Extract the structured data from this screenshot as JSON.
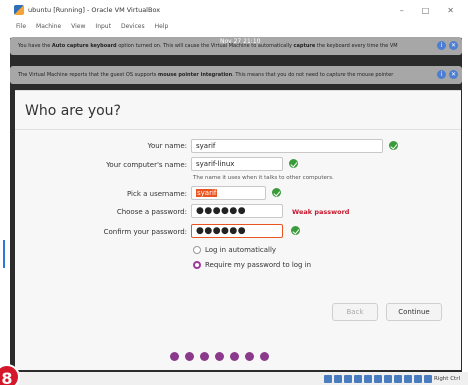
{
  "window": {
    "title": "ubuntu [Running] - Oracle VM VirtualBox",
    "minimize": "–",
    "maximize": "□",
    "close": "✕"
  },
  "menu": [
    "File",
    "Machine",
    "View",
    "Input",
    "Devices",
    "Help"
  ],
  "notices": {
    "clock": "Nov 27 21:10",
    "keyboard": {
      "pre": "You have the ",
      "bold1": "Auto capture keyboard",
      "mid": " option turned on. This will cause the Virtual Machine to automatically ",
      "bold2": "capture",
      "post": " the keyboard every time the VM"
    },
    "mouse": {
      "pre": "The Virtual Machine reports that the guest OS supports ",
      "bold1": "mouse pointer integration",
      "mid": ". This means that you do not need to ",
      "italic": "capture",
      "post": " the mouse pointer"
    }
  },
  "installer": {
    "title": "Who are you?",
    "your_name_label": "Your name:",
    "your_name_value": "syarif",
    "computer_name_label": "Your computer's name:",
    "computer_name_value": "syarif-linux",
    "computer_hint": "The name it uses when it talks to other computers.",
    "username_label": "Pick a username:",
    "username_value": "syarif",
    "password_label": "Choose a password:",
    "password_value": "●●●●●●",
    "password_strength": "Weak password",
    "confirm_label": "Confirm your password:",
    "confirm_value": "●●●●●●",
    "login_auto": "Log in automatically",
    "login_require": "Require my password to log in",
    "back": "Back",
    "continue": "Continue"
  },
  "statusbar": {
    "host_key": "Right Ctrl"
  },
  "badge": "8",
  "colors": {
    "accent": "#e95420",
    "ok": "#3a9b3a",
    "weak": "#c7162b",
    "progress": "#8b3a8b"
  }
}
